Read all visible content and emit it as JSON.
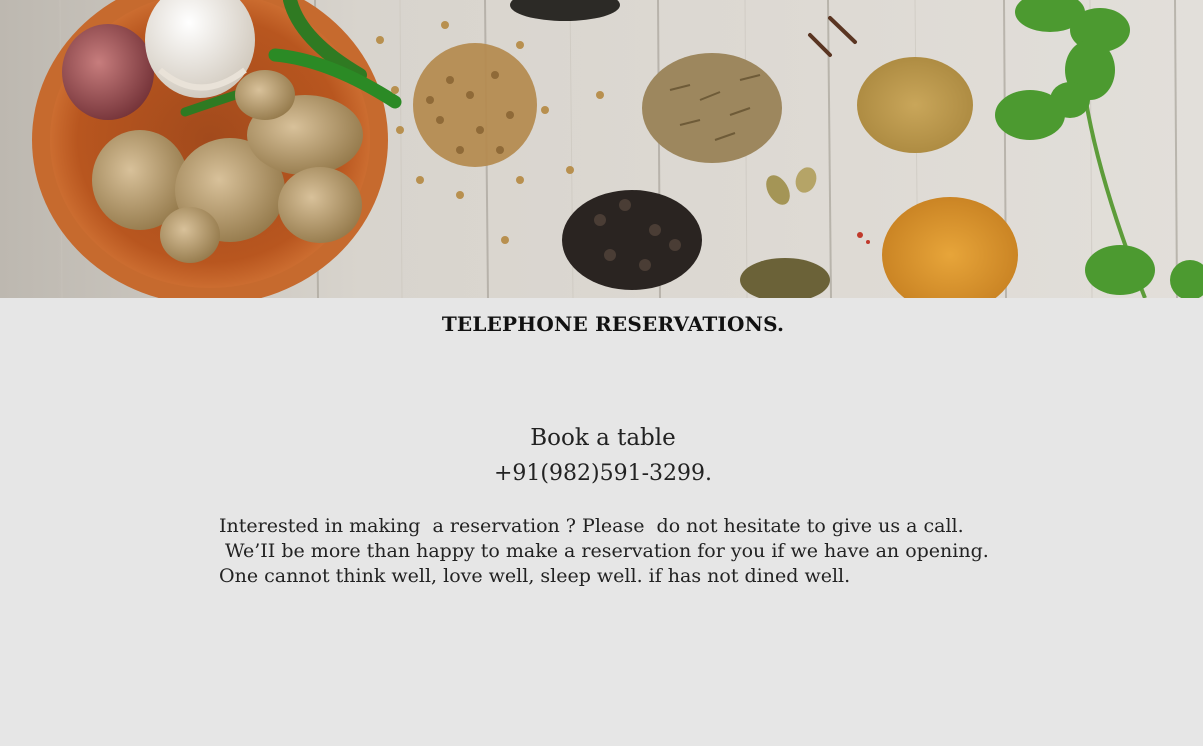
{
  "hero": {
    "image": "spices-on-wood-photo"
  },
  "section": {
    "title": "TELEPHONE RESERVATIONS."
  },
  "booking": {
    "label": "Book a table",
    "phone": "+91(982)591-3299."
  },
  "description": {
    "lines": [
      "Interested in making  a reservation ? Please  do not hesitate to give us a call.",
      " We’II be more than happy to make a reservation for you if we have an opening.",
      "One cannot think well, love well, sleep well. if has not dined well."
    ]
  },
  "colors": {
    "background": "#e6e6e6",
    "text": "#222222",
    "turmeric": "#d9952b",
    "wood": "#d9d6d0"
  }
}
